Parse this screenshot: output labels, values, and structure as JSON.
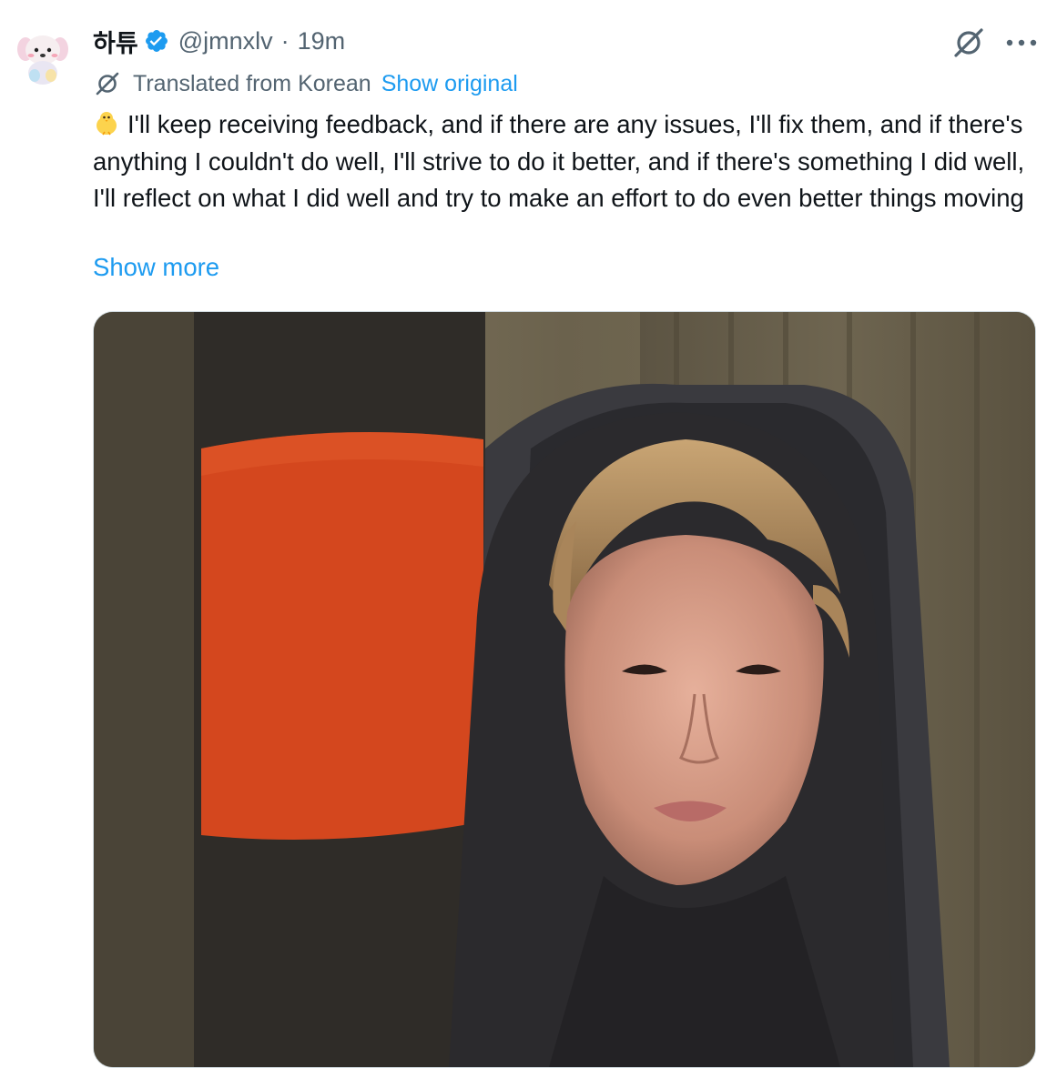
{
  "tweet": {
    "author": {
      "display_name": "하튜",
      "handle": "@jmnxlv",
      "verified": true,
      "avatar_icon": "plush-toy-avatar"
    },
    "separator": "·",
    "time": "19m",
    "translation": {
      "label": "Translated from Korean",
      "show_original_label": "Show original"
    },
    "emoji": "chick-emoji",
    "text": "I'll keep receiving feedback, and if there are any issues, I'll fix them, and if there's anything I couldn't do well, I'll strive to do it better, and if there's something I did well, I'll reflect on what I did well and try to make an effort to do even better things moving",
    "show_more_label": "Show more",
    "media": {
      "type": "video-still"
    }
  },
  "icons": {
    "verified": "verified-badge-icon",
    "grok": "grok-icon",
    "more": "more-icon",
    "translate": "translate-icon"
  },
  "colors": {
    "link": "#1d9bf0",
    "secondary_text": "#536471",
    "primary_text": "#0f1419",
    "verified": "#1d9bf0"
  }
}
